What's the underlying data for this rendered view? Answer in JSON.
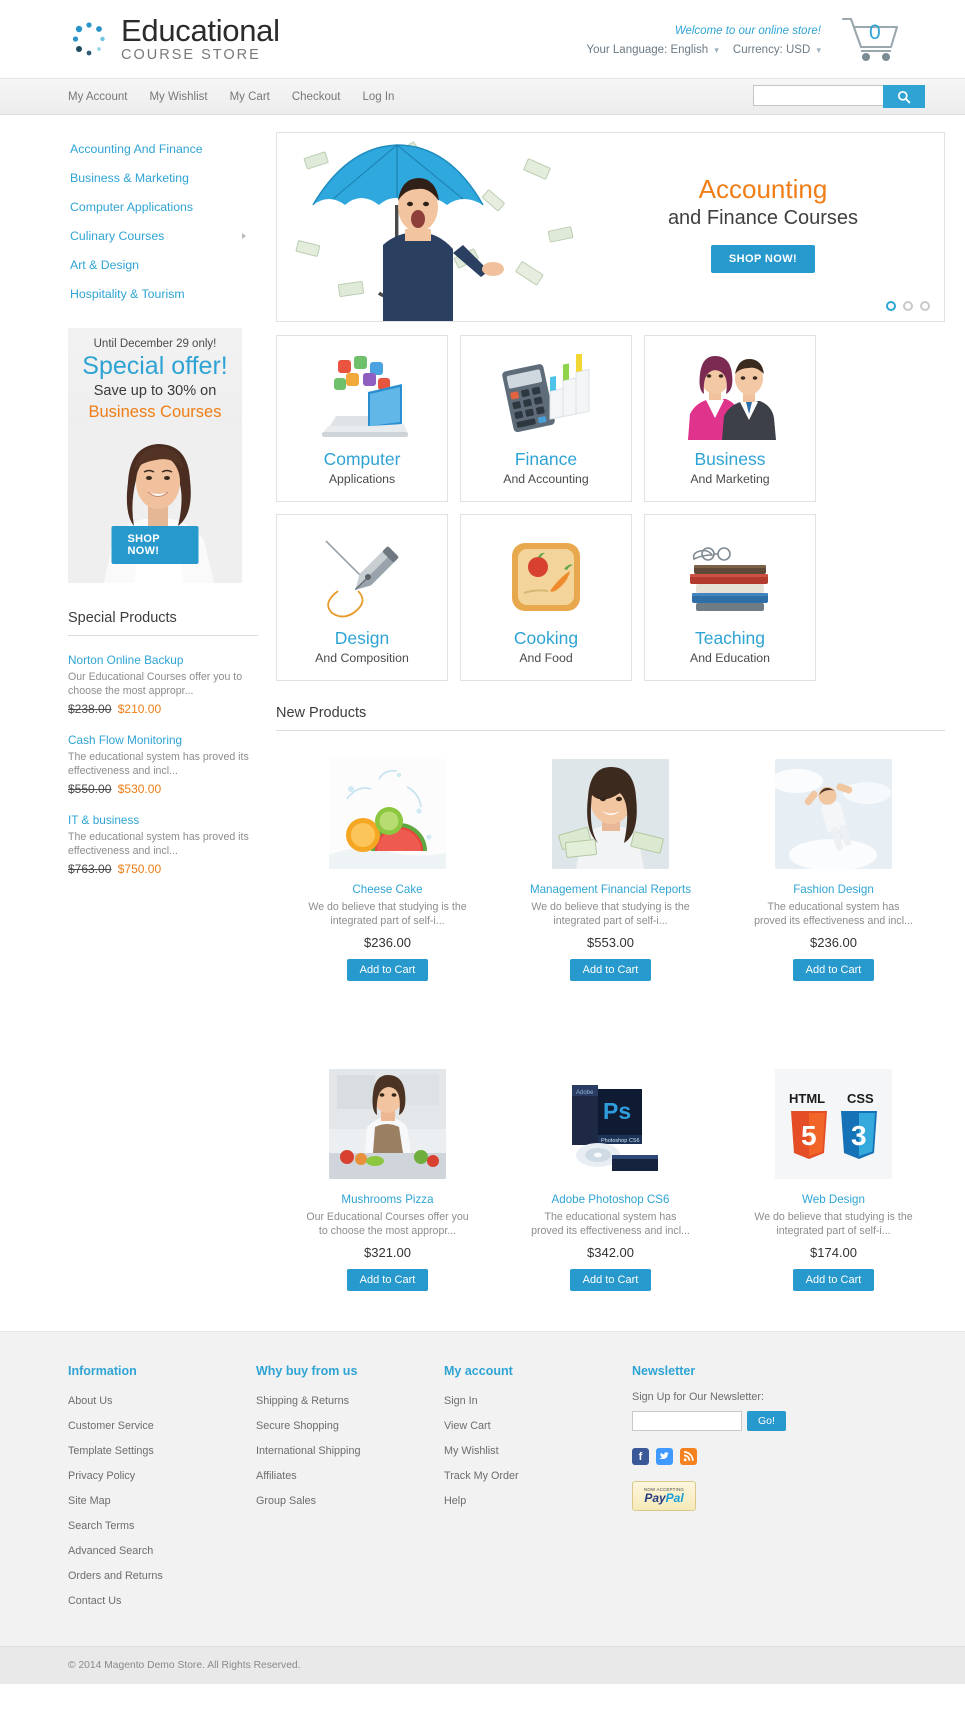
{
  "brand": {
    "name": "Educational",
    "tagline": "COURSE STORE",
    "logo_icon": "dots-circle-icon",
    "accent": "#2fa4d4",
    "orange": "#f07d15"
  },
  "header": {
    "welcome": "Welcome to our online store!",
    "language_label": "Your Language:",
    "language_value": "English",
    "currency_label": "Currency:",
    "currency_value": "USD",
    "cart_icon": "shopping-cart-icon",
    "cart_count": "0"
  },
  "nav": {
    "links": [
      {
        "label": "My Account"
      },
      {
        "label": "My Wishlist"
      },
      {
        "label": "My Cart"
      },
      {
        "label": "Checkout"
      },
      {
        "label": "Log In"
      }
    ],
    "search_placeholder": "",
    "search_value": "",
    "search_icon": "magnifier-icon"
  },
  "sidebar": {
    "categories": [
      {
        "label": "Accounting And Finance",
        "has_submenu": false
      },
      {
        "label": "Business & Marketing",
        "has_submenu": false
      },
      {
        "label": "Computer Applications",
        "has_submenu": false
      },
      {
        "label": "Culinary Courses",
        "has_submenu": true
      },
      {
        "label": "Art & Design",
        "has_submenu": false
      },
      {
        "label": "Hospitality & Tourism",
        "has_submenu": false
      }
    ],
    "promo": {
      "until": "Until December 29 only!",
      "title": "Special offer!",
      "save": "Save up to 30% on",
      "subject": "Business Courses",
      "button": "SHOP NOW!"
    },
    "special_products_title": "Special Products",
    "special_products": [
      {
        "name": "Norton Online Backup",
        "desc": "Our Educational Courses offer you to choose the most appropr...",
        "old_price": "$238.00",
        "new_price": "$210.00"
      },
      {
        "name": "Cash Flow Monitoring",
        "desc": "The educational system has proved its effectiveness and incl...",
        "old_price": "$550.00",
        "new_price": "$530.00"
      },
      {
        "name": "IT & business",
        "desc": "The educational system has proved its effectiveness and incl...",
        "old_price": "$763.00",
        "new_price": "$750.00"
      }
    ]
  },
  "slider": {
    "heading_orange": "Accounting",
    "heading_dark": "and Finance Courses",
    "button": "SHOP NOW!",
    "dots": 3,
    "active_dot": 0
  },
  "tiles": [
    {
      "name": "Computer",
      "sub": "Applications",
      "icon": "laptop-apps-icon"
    },
    {
      "name": "Finance",
      "sub": "And Accounting",
      "icon": "calculator-chart-icon"
    },
    {
      "name": "Business",
      "sub": "And Marketing",
      "icon": "business-people-icon"
    },
    {
      "name": "Design",
      "sub": "And Composition",
      "icon": "fountain-pen-icon"
    },
    {
      "name": "Cooking",
      "sub": "And Food",
      "icon": "cutting-board-icon"
    },
    {
      "name": "Teaching",
      "sub": "And Education",
      "icon": "book-stack-icon"
    }
  ],
  "new_products": {
    "title": "New Products",
    "add_to_cart_label": "Add to Cart",
    "items": [
      {
        "name": "Cheese Cake",
        "desc": "We do believe that studying is the integrated part of self-i...",
        "price": "$236.00",
        "image": "fruit-splash-photo"
      },
      {
        "name": "Management Financial Reports",
        "desc": "We do believe that studying is the integrated part of self-i...",
        "price": "$553.00",
        "image": "woman-with-money-photo"
      },
      {
        "name": "Fashion Design",
        "desc": "The educational system has proved its effectiveness and incl...",
        "price": "$236.00",
        "image": "jumping-person-sky-photo"
      },
      {
        "name": "Mushrooms Pizza",
        "desc": "Our Educational Courses offer you to choose the most appropr...",
        "price": "$321.00",
        "image": "chef-vegetables-photo"
      },
      {
        "name": "Adobe Photoshop CS6",
        "desc": "The educational system has proved its effectiveness and incl...",
        "price": "$342.00",
        "image": "photoshop-box-photo"
      },
      {
        "name": "Web Design",
        "desc": "We do believe that studying is the integrated part of self-i...",
        "price": "$174.00",
        "image": "html5-css3-logos"
      }
    ]
  },
  "footer": {
    "columns": [
      {
        "title": "Information",
        "links": [
          {
            "label": "About Us"
          },
          {
            "label": "Customer Service"
          },
          {
            "label": "Template Settings"
          },
          {
            "label": "Privacy Policy"
          },
          {
            "label": "Site Map"
          },
          {
            "label": "Search Terms"
          },
          {
            "label": "Advanced Search"
          },
          {
            "label": "Orders and Returns"
          },
          {
            "label": "Contact Us"
          }
        ]
      },
      {
        "title": "Why buy from us",
        "links": [
          {
            "label": "Shipping & Returns"
          },
          {
            "label": "Secure Shopping"
          },
          {
            "label": "International Shipping"
          },
          {
            "label": "Affiliates"
          },
          {
            "label": "Group Sales"
          }
        ]
      },
      {
        "title": "My account",
        "links": [
          {
            "label": "Sign In"
          },
          {
            "label": "View Cart"
          },
          {
            "label": "My Wishlist"
          },
          {
            "label": "Track My Order"
          },
          {
            "label": "Help"
          }
        ]
      }
    ],
    "newsletter": {
      "title": "Newsletter",
      "label": "Sign Up for Our Newsletter:",
      "input_value": "",
      "button": "Go!"
    },
    "socials": [
      {
        "name": "facebook-icon",
        "glyph": "f",
        "color": "#3b5998"
      },
      {
        "name": "twitter-icon",
        "glyph": "t",
        "color": "#4099ff"
      },
      {
        "name": "rss-icon",
        "glyph": "◜",
        "color": "#f58220"
      }
    ],
    "paypal": {
      "top": "NOW ACCEPTING",
      "name_1": "Pay",
      "name_2": "Pal"
    },
    "copyright": "© 2014 Magento Demo Store. All Rights Reserved."
  }
}
